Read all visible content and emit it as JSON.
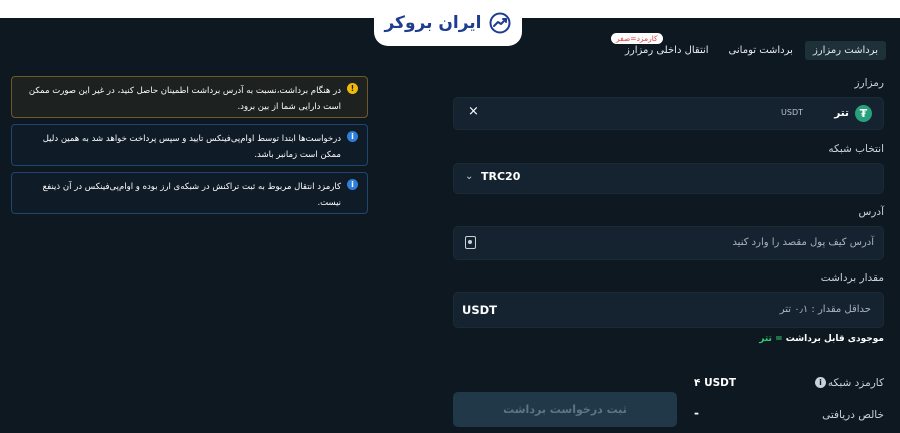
{
  "brand": {
    "name": "ایران بروکر"
  },
  "tabs": [
    {
      "label": "برداشت رمزارز",
      "active": true
    },
    {
      "label": "برداشت تومانی",
      "active": false
    },
    {
      "label": "انتقال داخلی رمزارز",
      "active": false,
      "badge": "کارمزد=صفر"
    }
  ],
  "form": {
    "asset_label": "رمزارز",
    "asset_name": "تتر",
    "asset_symbol": "USDT",
    "network_label": "انتخاب شبکه",
    "network_value": "TRC20",
    "address_label": "آدرس",
    "address_placeholder": "آدرس کیف پول مقصد را وارد کنید",
    "amount_label": "مقدار برداشت",
    "amount_placeholder": "حداقل مقدار : ۰٫۱ تتر",
    "amount_unit": "USDT",
    "balance_label": "موجودی قابل برداشت",
    "balance_value": "تتر",
    "network_fee_label": "کارمزد شبکه",
    "network_fee_value": "۴ USDT",
    "net_received_label": "خالص دریافتی",
    "net_received_value": "-",
    "submit_label": "ثبت درخواست برداشت"
  },
  "notices": [
    {
      "type": "warning",
      "text": "در هنگام برداشت،نسبت به آدرس برداشت اطمینان حاصل کنید، در غیر این صورت ممکن است دارایی شما از بین برود."
    },
    {
      "type": "info",
      "text": "درخواست‌ها ابتدا توسط اوام‌پی‌فینکس تایید و سپس پرداخت خواهد شد به همین دلیل ممکن است زمانبر باشد."
    },
    {
      "type": "info",
      "text": "کارمزد انتقال مربوط به ثبت تراکنش در شبکه‌ی ارز بوده و اوام‌پی‌فینکس در آن ذینفع نیست."
    }
  ],
  "icons": {
    "logo": "trend-chart-icon",
    "asset": "tether-icon",
    "clear": "close-icon",
    "dropdown": "chevron-down-icon",
    "address_book": "address-book-icon",
    "fee_info": "info-icon",
    "warning": "warning-icon",
    "info": "info-icon"
  },
  "colors": {
    "background": "#0e1821",
    "field": "#152230",
    "accent_green": "#2ecc71",
    "warning": "#f0b90b",
    "info": "#2f7fd8",
    "brand_blue": "#1e3d8f"
  }
}
